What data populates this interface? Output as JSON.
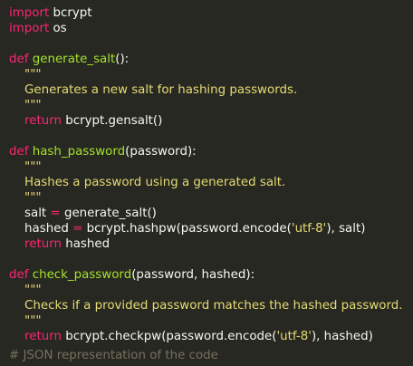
{
  "code": {
    "l1": {
      "kw": "import",
      "rest": " bcrypt"
    },
    "l2": {
      "kw": "import",
      "rest": " os"
    },
    "l4": {
      "kw": "def",
      "fn": "generate_salt",
      "rest": "():"
    },
    "l5": {
      "doc": "\"\"\""
    },
    "l6": {
      "doc": "Generates a new salt for hashing passwords."
    },
    "l7": {
      "doc": "\"\"\""
    },
    "l8": {
      "kw": "return",
      "rest": " bcrypt.gensalt()"
    },
    "l10": {
      "kw": "def",
      "fn": "hash_password",
      "rest": "(password):"
    },
    "l11": {
      "doc": "\"\"\""
    },
    "l12": {
      "doc": "Hashes a password using a generated salt."
    },
    "l13": {
      "doc": "\"\"\""
    },
    "l14": {
      "a": "salt ",
      "op": "=",
      "b": " generate_salt()"
    },
    "l15": {
      "a": "hashed ",
      "op": "=",
      "b1": " bcrypt.hashpw(password.encode(",
      "str": "'utf-8'",
      "b2": "), salt)"
    },
    "l16": {
      "kw": "return",
      "rest": " hashed"
    },
    "l18": {
      "kw": "def",
      "fn": "check_password",
      "rest": "(password, hashed):"
    },
    "l19": {
      "doc": "\"\"\""
    },
    "l20": {
      "doc": "Checks if a provided password matches the hashed password."
    },
    "l21": {
      "doc": "\"\"\""
    },
    "l22": {
      "kw": "return",
      "b1": " bcrypt.checkpw(password.encode(",
      "str": "'utf-8'",
      "b2": "), hashed)"
    },
    "l24": {
      "cmt": "# JSON representation of the code"
    }
  },
  "theme": {
    "background": "#272822",
    "keyword": "#f92672",
    "function": "#a6e22e",
    "docstring": "#e6db74",
    "comment": "#75715e",
    "text": "#f8f8f2"
  }
}
